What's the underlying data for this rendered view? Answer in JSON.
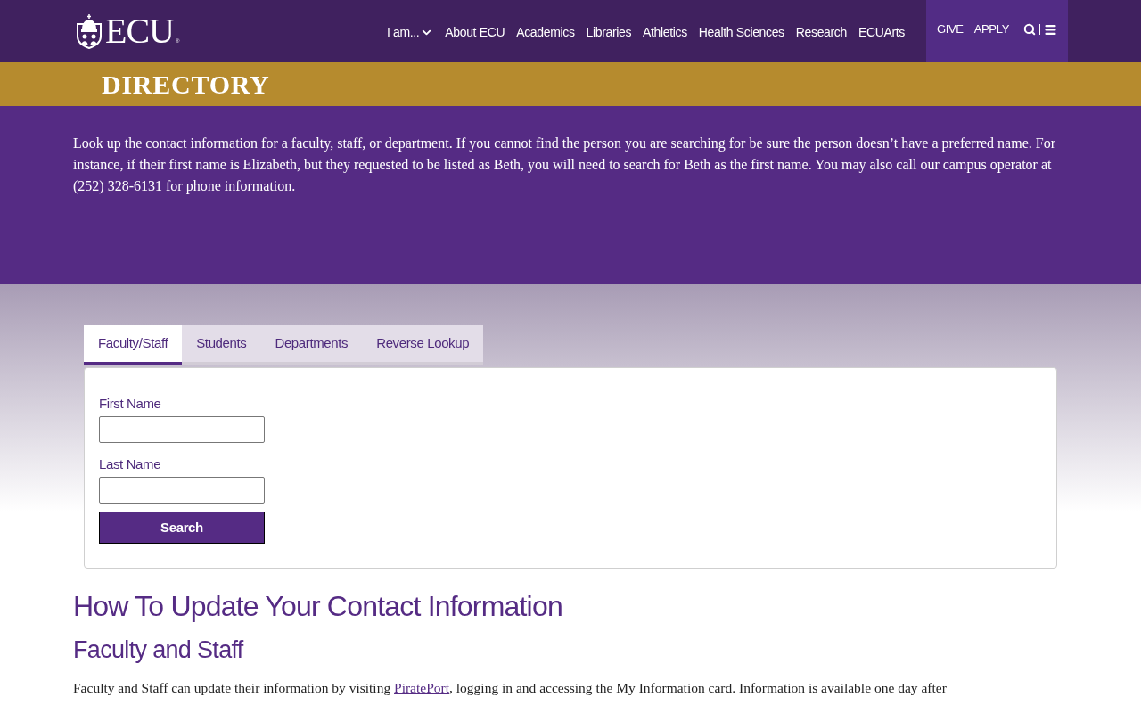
{
  "header": {
    "logo_text": "ECU",
    "logo_mark": "®",
    "nav": [
      {
        "label": "I am...",
        "kind": "dropdown"
      },
      {
        "label": "About ECU",
        "kind": "link"
      },
      {
        "label": "Academics",
        "kind": "link"
      },
      {
        "label": "Libraries",
        "kind": "link"
      },
      {
        "label": "Athletics",
        "kind": "link"
      },
      {
        "label": "Health Sciences",
        "kind": "link"
      },
      {
        "label": "Research",
        "kind": "link"
      },
      {
        "label": "ECUArts",
        "kind": "link"
      }
    ],
    "utility_links": [
      "GIVE",
      "APPLY"
    ]
  },
  "page_title": "DIRECTORY",
  "intro": "Look up the contact information for a faculty, staff, or department. If you cannot find the person you are searching for be sure the person doesn’t have a preferred name. For instance, if their first name is Elizabeth, but they requested to be listed as Beth, you will need to search for Beth as the first name. You may also call our campus operator at (252) 328-6131 for phone information.",
  "tabs": [
    {
      "label": "Faculty/Staff",
      "selected": true
    },
    {
      "label": "Students",
      "selected": false
    },
    {
      "label": "Departments",
      "selected": false
    },
    {
      "label": "Reverse Lookup",
      "selected": false
    }
  ],
  "form": {
    "fields": [
      {
        "label": "First Name"
      },
      {
        "label": "Last Name"
      }
    ],
    "submit": "Search"
  },
  "content": {
    "heading": "How To Update Your Contact Information",
    "subheading": "Faculty and Staff",
    "paragraph": {
      "before": "Faculty and Staff can update their information by visiting ",
      "link": "PiratePort",
      "after": ", logging in and accessing the My Information card. Information is available one day after"
    }
  }
}
